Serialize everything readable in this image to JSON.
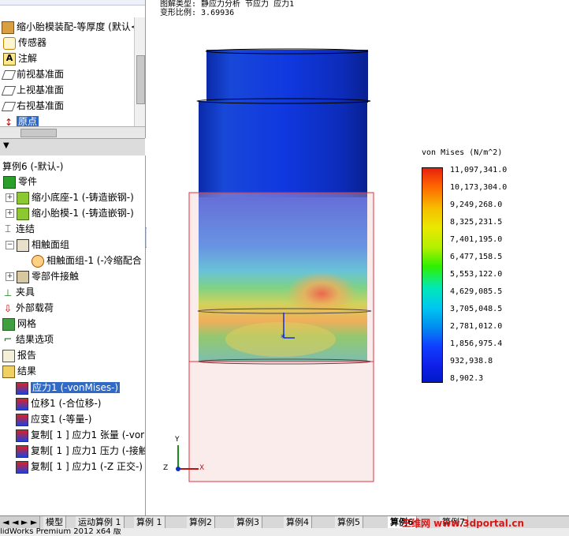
{
  "top_tree": {
    "assembly": "缩小胎模装配-等厚度 (默认<默",
    "items": [
      "传感器",
      "注解",
      "前视基准面",
      "上视基准面",
      "右视基准面",
      "原点"
    ]
  },
  "study_tree": {
    "root": "算例6 (-默认-)",
    "parts_header": "零件",
    "parts": [
      "缩小底座-1 (-铸造嵌钢-)",
      "缩小胎模-1 (-铸造嵌钢-)"
    ],
    "connections_header": "连结",
    "contact_set": "相触面组",
    "contact_item": "相触面组-1 (-冷缩配合",
    "component_contact": "零部件接触",
    "fixtures": "夹具",
    "loads": "外部载荷",
    "mesh": "网格",
    "result_options": "结果选项",
    "report": "报告",
    "results_header": "结果",
    "results": [
      "应力1 (-vonMises-)",
      "位移1 (-合位移-)",
      "应变1 (-等量-)",
      "复制[ 1 ] 应力1 张量 (-vor",
      "复制[ 1 ] 应力1 压力 (-接触",
      "复制[ 1 ] 应力1 (-Z 正交-)"
    ]
  },
  "plot_header": {
    "line1": "图解类型: 静应力分析 节应力 应力1",
    "line2": "变形比例: 3.69936"
  },
  "legend": {
    "title": "von Mises (N/m^2)",
    "values": [
      "11,097,341.0",
      "10,173,304.0",
      "9,249,268.0",
      "8,325,231.5",
      "7,401,195.0",
      "6,477,158.5",
      "5,553,122.0",
      "4,629,085.5",
      "3,705,048.5",
      "2,781,012.0",
      "1,856,975.4",
      "932,938.8",
      "8,902.3"
    ]
  },
  "triad": {
    "y": "Y",
    "x": "X",
    "z": "Z"
  },
  "tabs": [
    "模型",
    "运动算例 1",
    "算例 1",
    "算例2",
    "算例3",
    "算例4",
    "算例5",
    "算例6",
    "算例7"
  ],
  "active_tab": "算例6",
  "watermark": "三维网 www.3dportal.cn",
  "status": "lidWorks Premium 2012 x64 版"
}
